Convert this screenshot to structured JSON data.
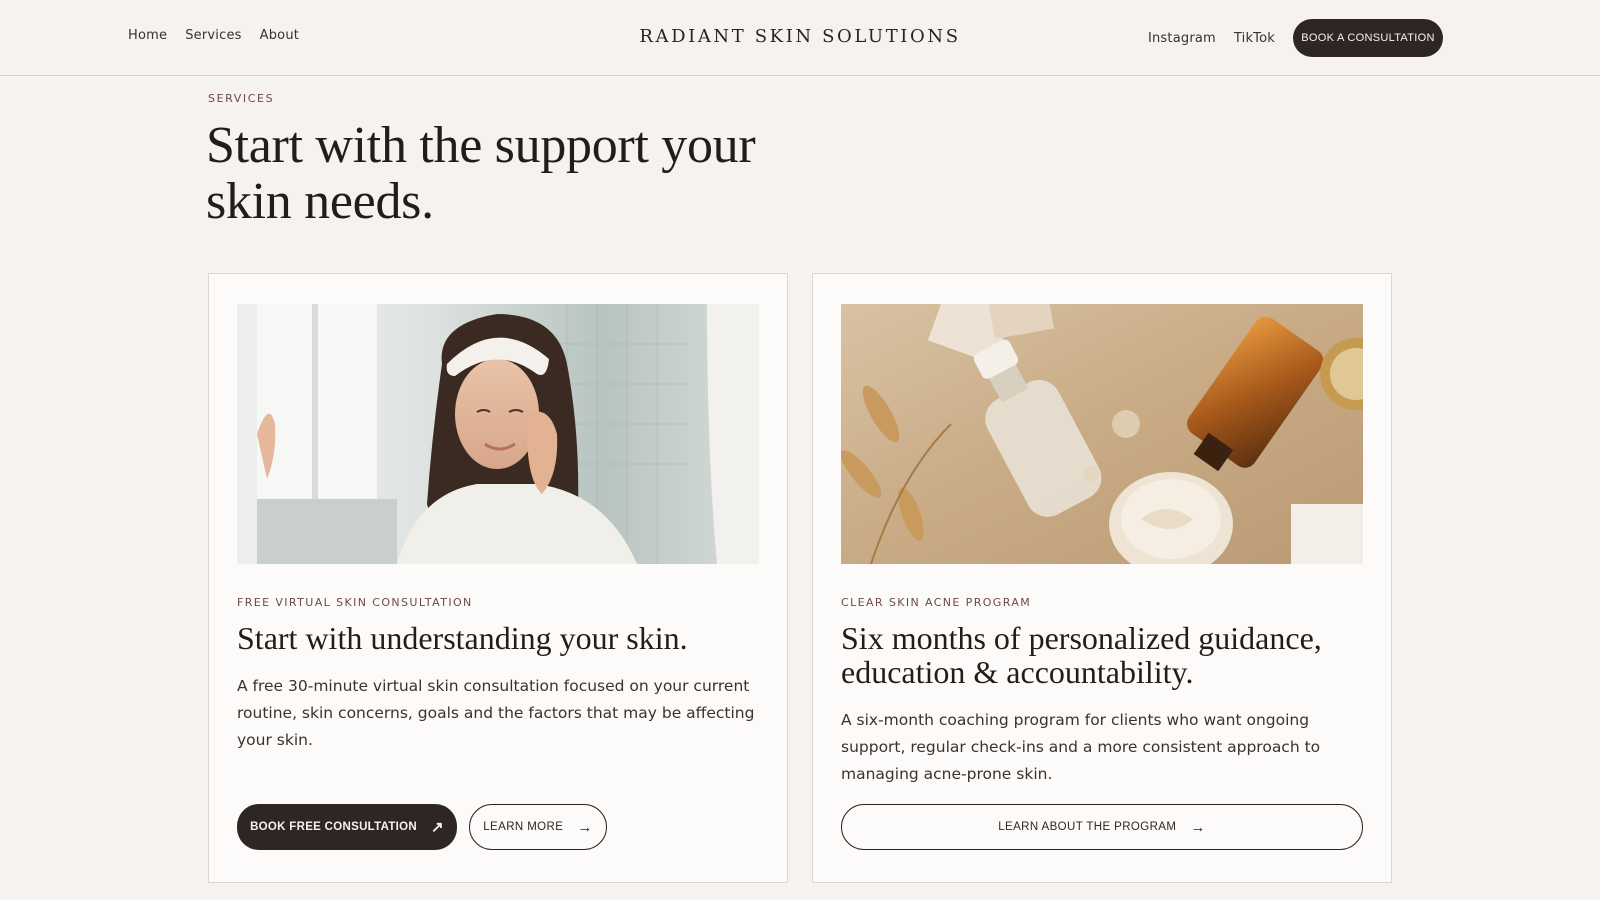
{
  "header": {
    "nav": [
      "Home",
      "Services",
      "About"
    ],
    "brand": "RADIANT SKIN SOLUTIONS",
    "social": [
      "Instagram",
      "TikTok"
    ],
    "cta": "BOOK A CONSULTATION"
  },
  "hero": {
    "eyebrow": "SERVICES",
    "title": "Start with the support your skin needs."
  },
  "cards": [
    {
      "label": "FREE VIRTUAL SKIN CONSULTATION",
      "title": "Start with understanding your skin.",
      "description": "A free 30-minute virtual skin consultation focused on your current routine, skin concerns, goals and the factors that may be affecting your skin.",
      "primary_button": "BOOK FREE CONSULTATION",
      "secondary_button": "LEARN MORE"
    },
    {
      "label": "CLEAR SKIN ACNE PROGRAM",
      "title": "Six months of personalized guidance, education & accountability.",
      "description": "A six-month coaching program for clients who want ongoing support, regular check-ins and a more consistent approach to managing acne-prone skin.",
      "button": "LEARN ABOUT THE PROGRAM"
    }
  ],
  "icons": {
    "external_arrow": "↗",
    "right_arrow": "→"
  },
  "colors": {
    "background": "#f6f2ef",
    "card": "#fdfbf9",
    "dark_button": "#2d2625",
    "accent_label": "#6d4a43"
  }
}
